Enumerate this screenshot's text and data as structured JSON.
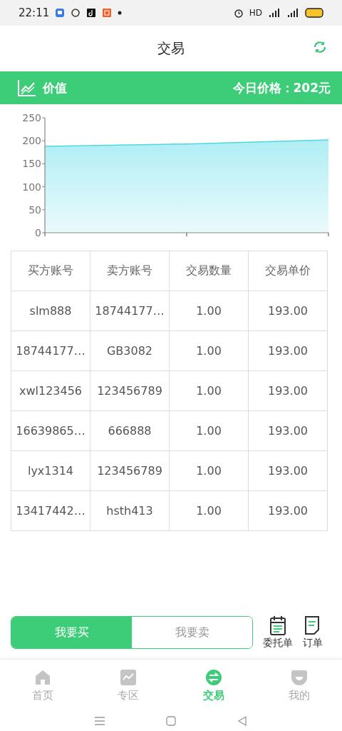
{
  "status_bar": {
    "time": "22:11",
    "hd": "HD"
  },
  "header": {
    "title": "交易"
  },
  "value_bar": {
    "label": "价值",
    "price": "今日价格：202元"
  },
  "chart": {
    "chart_data": {
      "type": "area",
      "values": [
        188,
        193,
        202
      ],
      "ylim": [
        0,
        250
      ],
      "yticks": [
        0,
        50,
        100,
        150,
        200,
        250
      ]
    }
  },
  "table": {
    "columns": [
      "买方账号",
      "卖方账号",
      "交易数量",
      "交易单价"
    ],
    "rows": [
      [
        "slm888",
        "18744177…",
        "1.00",
        "193.00"
      ],
      [
        "18744177…",
        "GB3082",
        "1.00",
        "193.00"
      ],
      [
        "xwl123456",
        "123456789",
        "1.00",
        "193.00"
      ],
      [
        "16639865…",
        "666888",
        "1.00",
        "193.00"
      ],
      [
        "lyx1314",
        "123456789",
        "1.00",
        "193.00"
      ],
      [
        "13417442…",
        "hsth413",
        "1.00",
        "193.00"
      ]
    ]
  },
  "actions": {
    "toggle": [
      {
        "label": "我要买",
        "selected": true
      },
      {
        "label": "我要卖",
        "selected": false
      }
    ],
    "links": [
      {
        "kind": "calendar",
        "label": "委托单"
      },
      {
        "kind": "document",
        "label": "订单"
      }
    ]
  },
  "tab_bar": [
    {
      "kind": "home",
      "label": "首页",
      "selected": false
    },
    {
      "kind": "chart",
      "label": "专区",
      "selected": false
    },
    {
      "kind": "swap",
      "label": "交易",
      "selected": true
    },
    {
      "kind": "profile",
      "label": "我的",
      "selected": false
    }
  ]
}
